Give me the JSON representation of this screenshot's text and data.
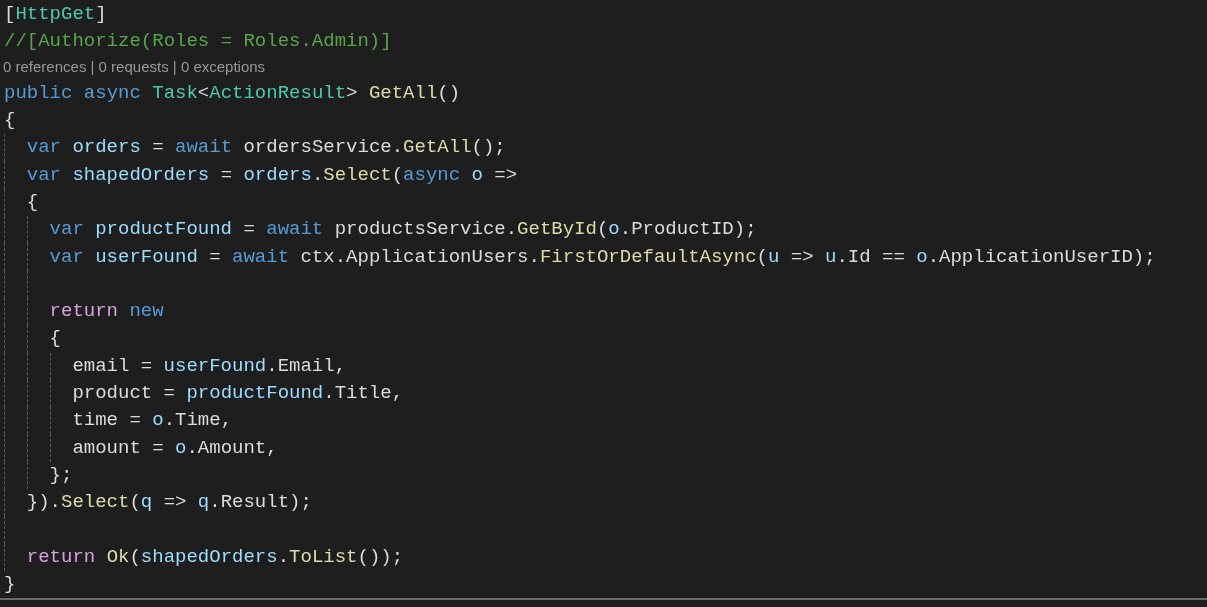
{
  "editor": {
    "lines": [
      {
        "tokens": [
          {
            "kind": "plain",
            "text": "["
          },
          {
            "kind": "type",
            "text": "HttpGet"
          },
          {
            "kind": "plain",
            "text": "]"
          }
        ]
      },
      {
        "tokens": [
          {
            "kind": "comment",
            "text": "//[Authorize(Roles = Roles.Admin)]"
          }
        ]
      },
      {
        "kind": "codelens",
        "tokens": [
          {
            "kind": "codelens",
            "text": "0 references | 0 requests | 0 exceptions"
          }
        ]
      },
      {
        "tokens": [
          {
            "kind": "keyword",
            "text": "public "
          },
          {
            "kind": "keyword",
            "text": "async "
          },
          {
            "kind": "type",
            "text": "Task"
          },
          {
            "kind": "plain",
            "text": "<"
          },
          {
            "kind": "type",
            "text": "ActionResult"
          },
          {
            "kind": "plain",
            "text": "> "
          },
          {
            "kind": "method",
            "text": "GetAll"
          },
          {
            "kind": "plain",
            "text": "()"
          }
        ]
      },
      {
        "tokens": [
          {
            "kind": "plain",
            "text": "{"
          }
        ]
      },
      {
        "tokens": [
          {
            "kind": "indent"
          },
          {
            "kind": "keyword",
            "text": "var "
          },
          {
            "kind": "variable",
            "text": "orders"
          },
          {
            "kind": "plain",
            "text": " = "
          },
          {
            "kind": "keyword",
            "text": "await "
          },
          {
            "kind": "plain",
            "text": "ordersService."
          },
          {
            "kind": "method",
            "text": "GetAll"
          },
          {
            "kind": "plain",
            "text": "();"
          }
        ]
      },
      {
        "tokens": [
          {
            "kind": "indent"
          },
          {
            "kind": "keyword",
            "text": "var "
          },
          {
            "kind": "variable",
            "text": "shapedOrders"
          },
          {
            "kind": "plain",
            "text": " = "
          },
          {
            "kind": "variable",
            "text": "orders"
          },
          {
            "kind": "plain",
            "text": "."
          },
          {
            "kind": "method",
            "text": "Select"
          },
          {
            "kind": "plain",
            "text": "("
          },
          {
            "kind": "keyword",
            "text": "async "
          },
          {
            "kind": "variable",
            "text": "o"
          },
          {
            "kind": "plain",
            "text": " =>"
          }
        ]
      },
      {
        "tokens": [
          {
            "kind": "indent"
          },
          {
            "kind": "plain",
            "text": "{"
          }
        ]
      },
      {
        "tokens": [
          {
            "kind": "indent"
          },
          {
            "kind": "indent"
          },
          {
            "kind": "keyword",
            "text": "var "
          },
          {
            "kind": "variable",
            "text": "productFound"
          },
          {
            "kind": "plain",
            "text": " = "
          },
          {
            "kind": "keyword",
            "text": "await "
          },
          {
            "kind": "plain",
            "text": "productsService."
          },
          {
            "kind": "method",
            "text": "GetById"
          },
          {
            "kind": "plain",
            "text": "("
          },
          {
            "kind": "variable",
            "text": "o"
          },
          {
            "kind": "plain",
            "text": ".ProductID);"
          }
        ]
      },
      {
        "tokens": [
          {
            "kind": "indent"
          },
          {
            "kind": "indent"
          },
          {
            "kind": "keyword",
            "text": "var "
          },
          {
            "kind": "variable",
            "text": "userFound"
          },
          {
            "kind": "plain",
            "text": " = "
          },
          {
            "kind": "keyword",
            "text": "await "
          },
          {
            "kind": "plain",
            "text": "ctx.ApplicationUsers."
          },
          {
            "kind": "method",
            "text": "FirstOrDefaultAsync"
          },
          {
            "kind": "plain",
            "text": "("
          },
          {
            "kind": "variable",
            "text": "u"
          },
          {
            "kind": "plain",
            "text": " => "
          },
          {
            "kind": "variable",
            "text": "u"
          },
          {
            "kind": "plain",
            "text": ".Id == "
          },
          {
            "kind": "variable",
            "text": "o"
          },
          {
            "kind": "plain",
            "text": ".ApplicationUserID);"
          }
        ]
      },
      {
        "tokens": [
          {
            "kind": "indent"
          },
          {
            "kind": "indent"
          }
        ]
      },
      {
        "tokens": [
          {
            "kind": "indent"
          },
          {
            "kind": "indent"
          },
          {
            "kind": "control",
            "text": "return "
          },
          {
            "kind": "keyword",
            "text": "new"
          }
        ]
      },
      {
        "tokens": [
          {
            "kind": "indent"
          },
          {
            "kind": "indent"
          },
          {
            "kind": "plain",
            "text": "{"
          }
        ]
      },
      {
        "tokens": [
          {
            "kind": "indent"
          },
          {
            "kind": "indent"
          },
          {
            "kind": "indent"
          },
          {
            "kind": "plain",
            "text": "email = "
          },
          {
            "kind": "variable",
            "text": "userFound"
          },
          {
            "kind": "plain",
            "text": ".Email,"
          }
        ]
      },
      {
        "tokens": [
          {
            "kind": "indent"
          },
          {
            "kind": "indent"
          },
          {
            "kind": "indent"
          },
          {
            "kind": "plain",
            "text": "product = "
          },
          {
            "kind": "variable",
            "text": "productFound"
          },
          {
            "kind": "plain",
            "text": ".Title,"
          }
        ]
      },
      {
        "tokens": [
          {
            "kind": "indent"
          },
          {
            "kind": "indent"
          },
          {
            "kind": "indent"
          },
          {
            "kind": "plain",
            "text": "time = "
          },
          {
            "kind": "variable",
            "text": "o"
          },
          {
            "kind": "plain",
            "text": ".Time,"
          }
        ]
      },
      {
        "tokens": [
          {
            "kind": "indent"
          },
          {
            "kind": "indent"
          },
          {
            "kind": "indent"
          },
          {
            "kind": "plain",
            "text": "amount = "
          },
          {
            "kind": "variable",
            "text": "o"
          },
          {
            "kind": "plain",
            "text": ".Amount,"
          }
        ]
      },
      {
        "tokens": [
          {
            "kind": "indent"
          },
          {
            "kind": "indent"
          },
          {
            "kind": "plain",
            "text": "};"
          }
        ]
      },
      {
        "tokens": [
          {
            "kind": "indent"
          },
          {
            "kind": "plain",
            "text": "})."
          },
          {
            "kind": "method",
            "text": "Select"
          },
          {
            "kind": "plain",
            "text": "("
          },
          {
            "kind": "variable",
            "text": "q"
          },
          {
            "kind": "plain",
            "text": " => "
          },
          {
            "kind": "variable",
            "text": "q"
          },
          {
            "kind": "plain",
            "text": ".Result);"
          }
        ]
      },
      {
        "tokens": [
          {
            "kind": "indent"
          }
        ]
      },
      {
        "tokens": [
          {
            "kind": "indent"
          },
          {
            "kind": "control",
            "text": "return "
          },
          {
            "kind": "method",
            "text": "Ok"
          },
          {
            "kind": "plain",
            "text": "("
          },
          {
            "kind": "variable",
            "text": "shapedOrders"
          },
          {
            "kind": "plain",
            "text": "."
          },
          {
            "kind": "method",
            "text": "ToList"
          },
          {
            "kind": "plain",
            "text": "());"
          }
        ]
      },
      {
        "tokens": [
          {
            "kind": "plain",
            "text": "}"
          }
        ]
      }
    ]
  }
}
